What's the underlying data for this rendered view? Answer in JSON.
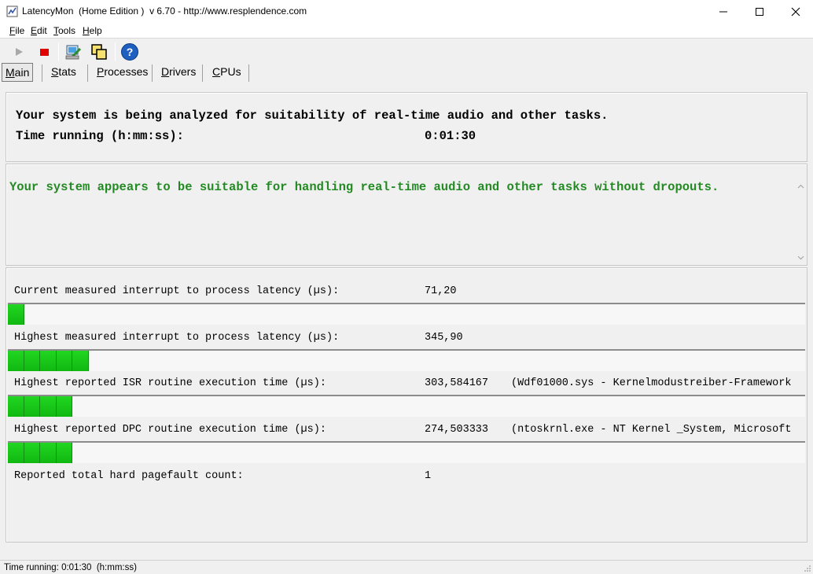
{
  "window": {
    "title": "LatencyMon  (Home Edition )  v 6.70 - http://www.resplendence.com"
  },
  "menu": [
    {
      "label_u": "F",
      "label_rest": "ile"
    },
    {
      "label_u": "E",
      "label_rest": "dit"
    },
    {
      "label_u": "T",
      "label_rest": "ools"
    },
    {
      "label_u": "H",
      "label_rest": "elp"
    }
  ],
  "toolbar": {
    "icons": [
      "play-icon",
      "stop-icon",
      "analyze-icon",
      "windows-icon",
      "help-icon"
    ],
    "stop_color": "#e00000",
    "help_color": "#1e5fbf"
  },
  "tabs": [
    {
      "label_u": "M",
      "label_rest": "ain",
      "active": true
    },
    {
      "label_u": "S",
      "label_rest": "tats"
    },
    {
      "label_u": "P",
      "label_rest": "rocesses"
    },
    {
      "label_u": "D",
      "label_rest": "rivers"
    },
    {
      "label_u": "C",
      "label_rest": "PUs"
    }
  ],
  "analysis": {
    "line1": "Your system is being analyzed for suitability of real-time audio and other tasks.",
    "time_label": "Time running (h:mm:ss):",
    "time_value": "0:01:30"
  },
  "verdict": {
    "text": "Your system appears to be suitable for handling real-time audio and other tasks without dropouts.",
    "color": "#238a23"
  },
  "metrics": [
    {
      "label": "Current measured interrupt to process latency (µs):",
      "value": "71,20",
      "detail": "",
      "bar_segments": 1
    },
    {
      "label": "Highest measured interrupt to process latency (µs):",
      "value": "345,90",
      "detail": "",
      "bar_segments": 5
    },
    {
      "label": "Highest reported ISR routine execution time (µs):",
      "value": "303,584167",
      "detail": "(Wdf01000.sys - Kernelmodustreiber-Framework",
      "bar_segments": 4
    },
    {
      "label": "Highest reported DPC routine execution time (µs):",
      "value": "274,503333",
      "detail": "(ntoskrnl.exe - NT Kernel _System, Microsoft",
      "bar_segments": 4
    },
    {
      "label": "Reported total hard pagefault count:",
      "value": "1",
      "detail": ""
    }
  ],
  "status": {
    "text": "Time running: 0:01:30  (h:mm:ss)"
  },
  "colors": {
    "bar_green": "#16c816"
  }
}
